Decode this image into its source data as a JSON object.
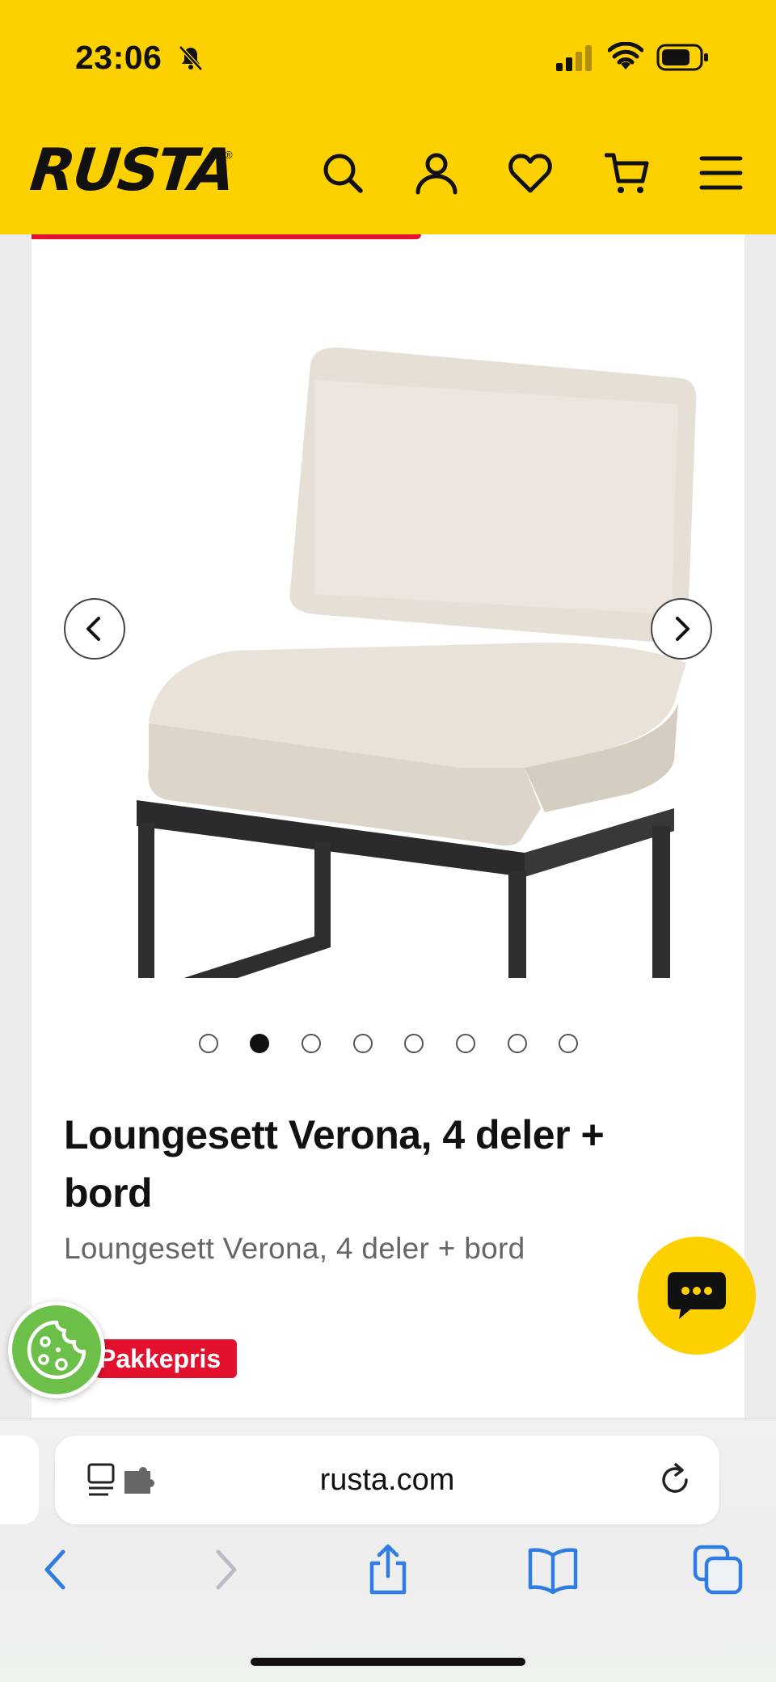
{
  "status_bar": {
    "time": "23:06"
  },
  "header": {
    "logo_text": "RUSTA",
    "logo_mark": "®",
    "icons": [
      "search-icon",
      "account-icon",
      "heart-icon",
      "cart-icon",
      "menu-icon"
    ]
  },
  "carousel": {
    "dot_count": 8,
    "active_index": 1
  },
  "product": {
    "title": "Loungesett Verona, 4 deler + bord",
    "subtitle": "Loungesett Verona, 4 deler + bord",
    "badge": "Pakkepris"
  },
  "browser": {
    "url": "rusta.com"
  },
  "colors": {
    "brand_yellow": "#fdd000",
    "badge_red": "#e3112e",
    "cookie_green": "#6cc04a",
    "safari_blue": "#2f7de1"
  }
}
